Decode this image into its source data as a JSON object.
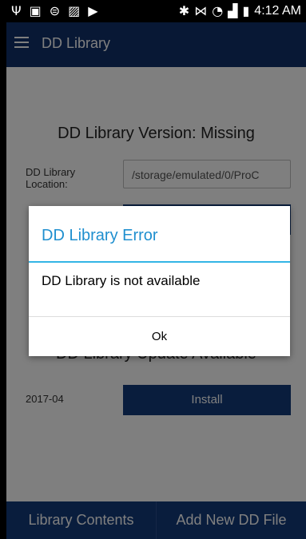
{
  "status_bar": {
    "time": "4:12 AM",
    "left_icons": [
      "usb-icon",
      "battery-full-icon",
      "wifi-download-icon",
      "image-icon",
      "play-store-icon"
    ],
    "right_icons": [
      "bluetooth-icon",
      "vibrate-icon",
      "wifi-icon",
      "signal-icon",
      "battery-charging-icon"
    ]
  },
  "app_bar": {
    "title": "DD Library"
  },
  "content": {
    "version_title": "DD Library Version: Missing",
    "location_label": "DD Library Location:",
    "location_value": "/storage/emulated/0/ProC",
    "update_title": "DD Library Update Available",
    "update_date": "2017-04",
    "install_label": "Install"
  },
  "tabs": [
    {
      "label": "Library Contents"
    },
    {
      "label": "Add New DD File"
    }
  ],
  "dialog": {
    "title": "DD Library Error",
    "message": "DD Library is not available",
    "ok_label": "Ok"
  },
  "colors": {
    "primary": "#133a7a",
    "app_bar": "#10306a",
    "dialog_title": "#1f8fcf",
    "dialog_divider": "#33b5e5"
  }
}
